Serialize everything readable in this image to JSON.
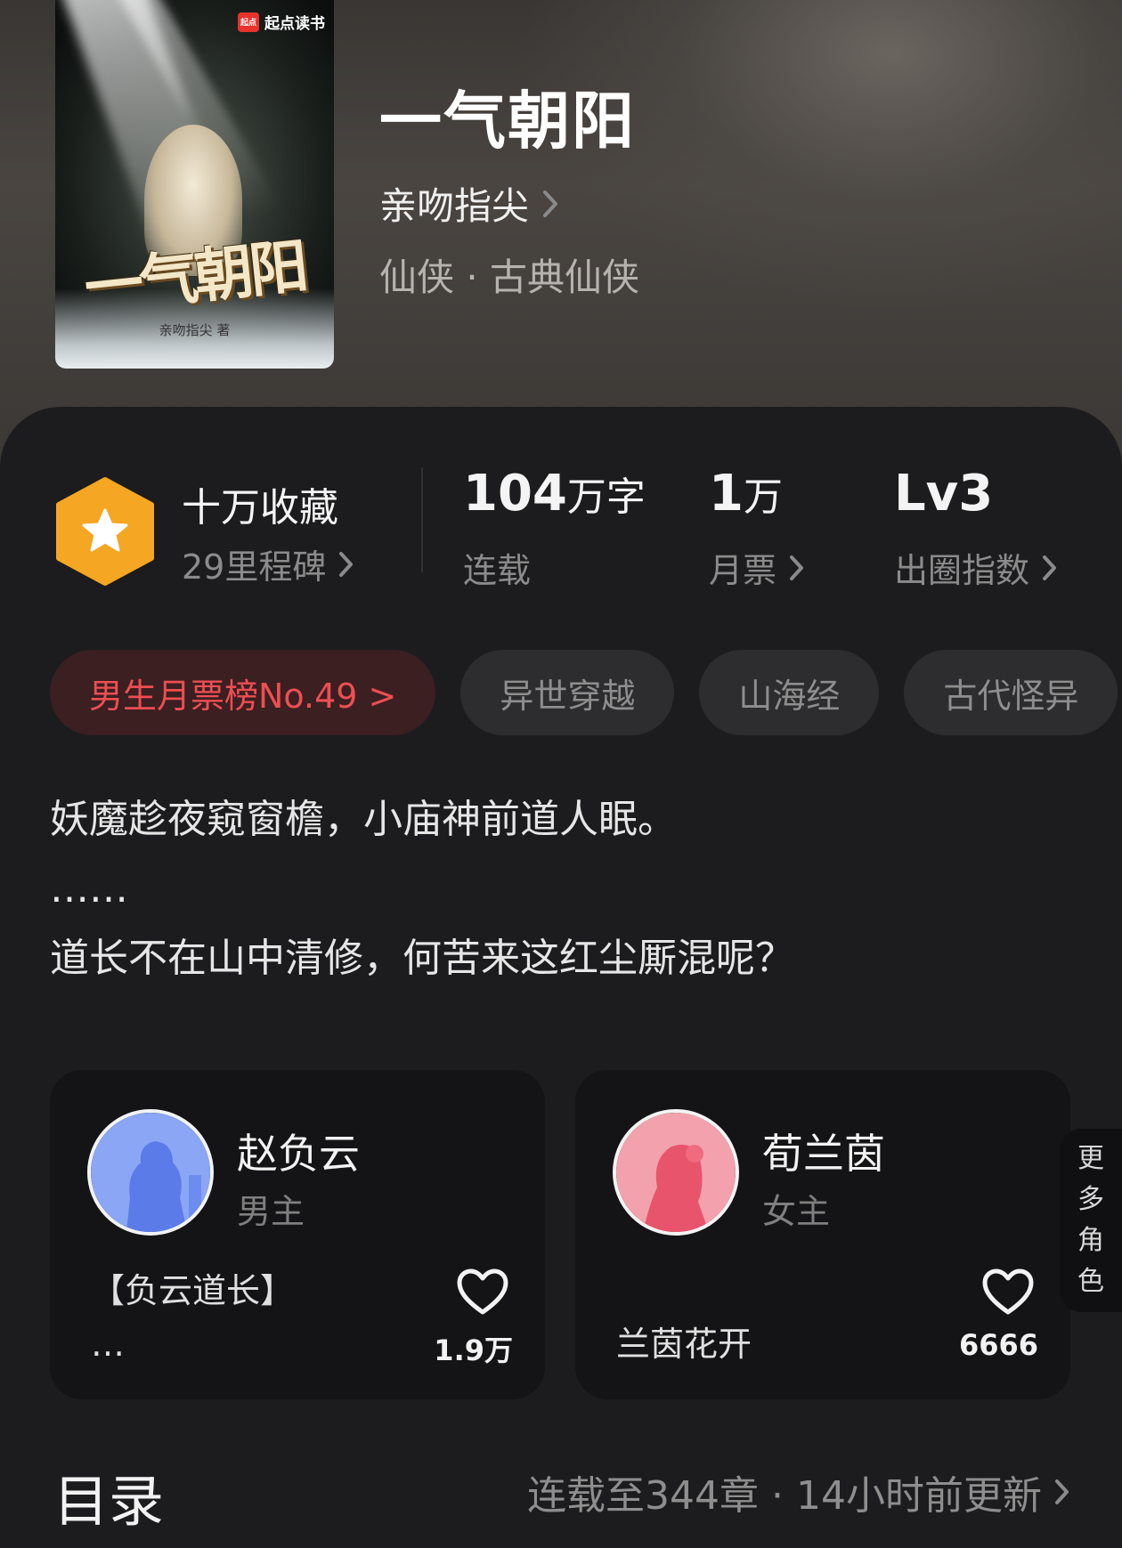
{
  "cover": {
    "brand_logo": "起点",
    "brand": "起点读书",
    "title_art": "一气朝阳",
    "author_art": "亲吻指尖 著"
  },
  "book": {
    "title": "一气朝阳",
    "author": "亲吻指尖",
    "genre": "仙侠 · 古典仙侠"
  },
  "stats": {
    "badge_icon": "star-badge-icon",
    "badge_color": "#f5a623",
    "favorites": "十万收藏",
    "milestones": "29里程碑",
    "word_count_num": "104",
    "word_count_unit": "万字",
    "status": "连载",
    "monthly_votes_num": "1",
    "monthly_votes_unit": "万",
    "monthly_votes_label": "月票",
    "circle_level": "Lv3",
    "circle_label": "出圈指数"
  },
  "tags": [
    "男生月票榜No.49 >",
    "异世穿越",
    "山海经",
    "古代怪异"
  ],
  "description": [
    "妖魔趁夜窥窗檐，小庙神前道人眠。",
    "……",
    "道长不在山中清修，何苦来这红尘厮混呢？"
  ],
  "roles": [
    {
      "name": "赵负云",
      "type": "男主",
      "desc_line1": "【负云道长】",
      "desc_line2": "…",
      "likes": "1.9万",
      "avatar_color": "#7c9cf0"
    },
    {
      "name": "荀兰茵",
      "type": "女主",
      "desc_line1": "兰茵花开",
      "likes": "6666",
      "avatar_color": "#f06a80"
    }
  ],
  "more_roles": [
    "更",
    "多",
    "角",
    "色"
  ],
  "toc": {
    "title": "目录",
    "info": "连载至344章 · 14小时前更新"
  }
}
